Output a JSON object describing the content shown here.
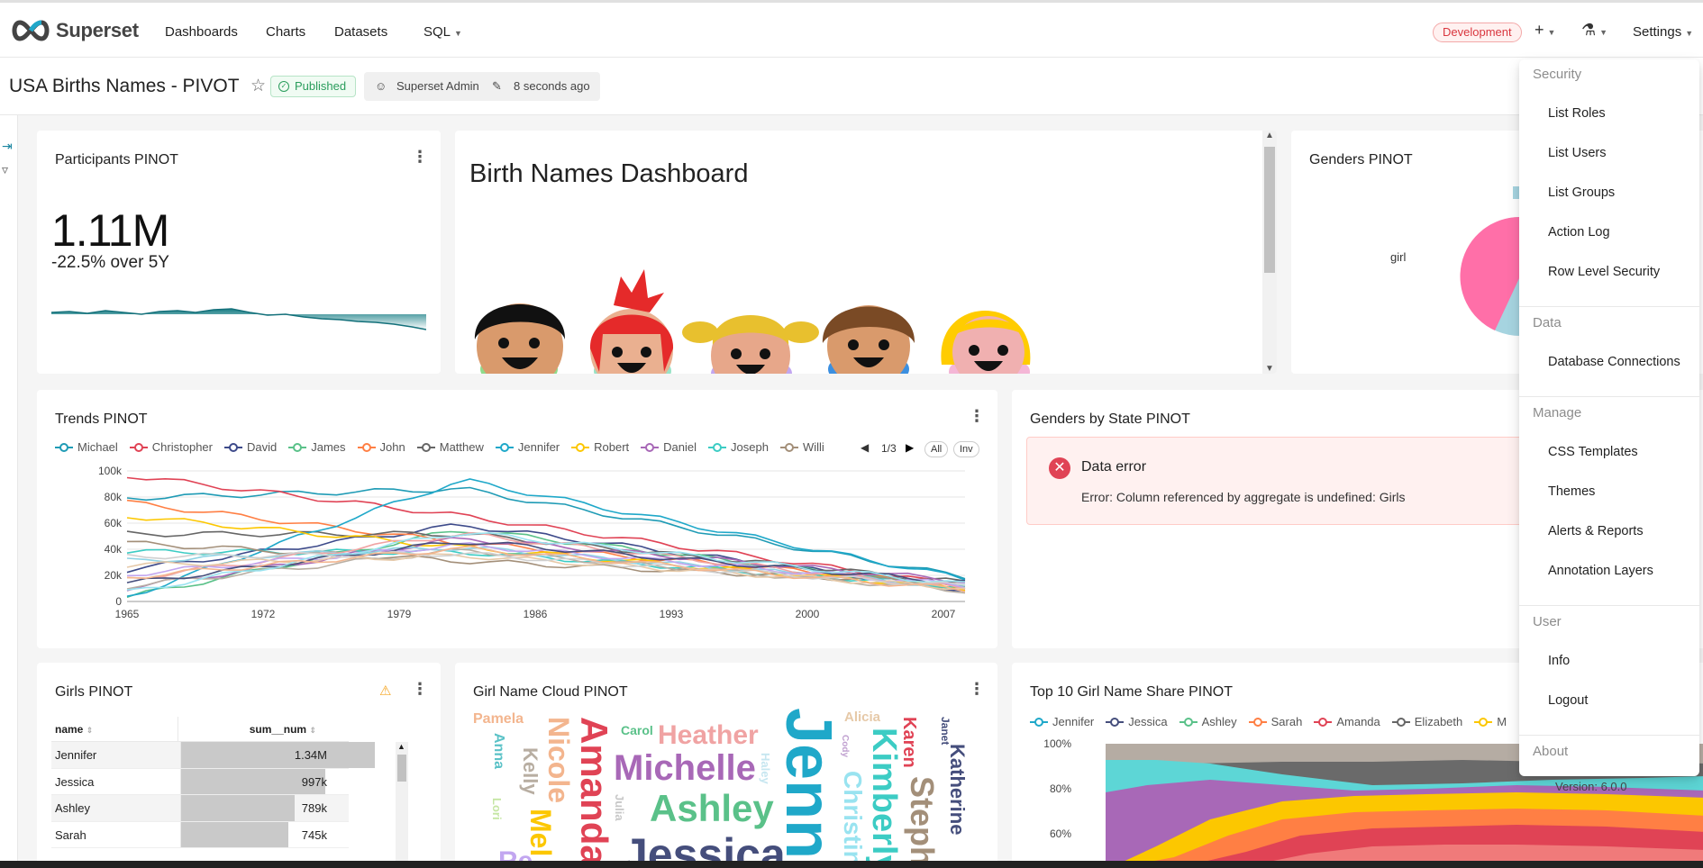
{
  "nav": {
    "brand": "Superset",
    "links": [
      "Dashboards",
      "Charts",
      "Datasets"
    ],
    "sql": "SQL",
    "env_badge": "Development",
    "settings": "Settings"
  },
  "header": {
    "title": "USA Births Names - PIVOT",
    "status": "Published",
    "owner": "Superset Admin",
    "modified": "8 seconds ago"
  },
  "participants": {
    "title": "Participants PINOT",
    "value": "1.11M",
    "subtitle": "-22.5% over 5Y"
  },
  "markdown": {
    "title": "Birth Names Dashboard"
  },
  "genders": {
    "title": "Genders PINOT",
    "label_girl": "girl"
  },
  "trends": {
    "title": "Trends PINOT",
    "legend": [
      {
        "name": "Michael",
        "color": "#1f9bb5"
      },
      {
        "name": "Christopher",
        "color": "#e04355"
      },
      {
        "name": "David",
        "color": "#3d4a8a"
      },
      {
        "name": "James",
        "color": "#5ac189"
      },
      {
        "name": "John",
        "color": "#ff7f44"
      },
      {
        "name": "Matthew",
        "color": "#666666"
      },
      {
        "name": "Jennifer",
        "color": "#1fa8c9"
      },
      {
        "name": "Robert",
        "color": "#fcc700"
      },
      {
        "name": "Daniel",
        "color": "#a868b7"
      },
      {
        "name": "Joseph",
        "color": "#3cccc4"
      },
      {
        "name": "Willi",
        "color": "#a38f79"
      }
    ],
    "pager": "1/3",
    "btn_all": "All",
    "btn_inv": "Inv",
    "y_ticks": [
      "100k",
      "80k",
      "60k",
      "40k",
      "20k",
      "0"
    ],
    "x_ticks": [
      "1965",
      "1972",
      "1979",
      "1986",
      "1993",
      "2000",
      "2007"
    ]
  },
  "genders_by_state": {
    "title": "Genders by State PINOT",
    "error_title": "Data error",
    "error_message": "Error: Column referenced by aggregate is undefined: Girls"
  },
  "girls": {
    "title": "Girls PINOT",
    "col_name": "name",
    "col_value": "sum__num",
    "rows": [
      {
        "name": "Jennifer",
        "value": "1.34M",
        "frac": 1.0
      },
      {
        "name": "Jessica",
        "value": "997k",
        "frac": 0.744
      },
      {
        "name": "Ashley",
        "value": "789k",
        "frac": 0.589
      },
      {
        "name": "Sarah",
        "value": "745k",
        "frac": 0.556
      }
    ]
  },
  "cloud": {
    "title": "Girl Name Cloud PINOT",
    "words": [
      "Pamela",
      "Anna",
      "Lori",
      "Kelly",
      "Nicole",
      "Amanda",
      "Carol",
      "Heather",
      "Michelle",
      "Julia",
      "Ashley",
      "Jessica",
      "Jenni",
      "Alicia",
      "Haley",
      "Cody",
      "Kimberly",
      "Christina",
      "Karen",
      "Janet",
      "Katherine",
      "Steph",
      "Re",
      "Mel"
    ]
  },
  "top10": {
    "title": "Top 10 Girl Name Share PINOT",
    "legend": [
      {
        "name": "Jennifer",
        "color": "#1fa8c9"
      },
      {
        "name": "Jessica",
        "color": "#454e7c"
      },
      {
        "name": "Ashley",
        "color": "#5ac189"
      },
      {
        "name": "Sarah",
        "color": "#ff7f44"
      },
      {
        "name": "Amanda",
        "color": "#e04355"
      },
      {
        "name": "Elizabeth",
        "color": "#666666"
      },
      {
        "name": "M",
        "color": "#fcc700"
      }
    ],
    "y_ticks": [
      "100%",
      "80%",
      "60%"
    ]
  },
  "menu": {
    "groups": [
      {
        "label": "Security",
        "items": [
          "List Roles",
          "List Users",
          "List Groups",
          "Action Log",
          "Row Level Security"
        ]
      },
      {
        "label": "Data",
        "items": [
          "Database Connections"
        ]
      },
      {
        "label": "Manage",
        "items": [
          "CSS Templates",
          "Themes",
          "Alerts & Reports",
          "Annotation Layers"
        ]
      },
      {
        "label": "User",
        "items": [
          "Info",
          "Logout"
        ]
      },
      {
        "label": "About",
        "items": []
      }
    ],
    "version": "Version: 6.0.0"
  }
}
